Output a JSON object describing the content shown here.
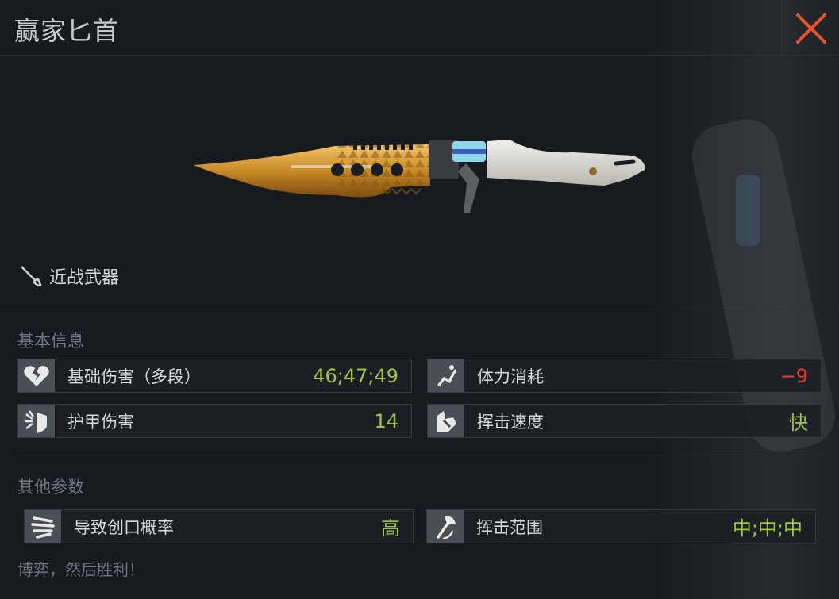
{
  "window": {
    "title": "赢家匕首"
  },
  "weapon": {
    "category": "近战武器"
  },
  "basic_info": {
    "title": "基本信息",
    "stats": [
      {
        "label": "基础伤害（多段）",
        "value": "46;47;49",
        "icon": "broken-heart-icon"
      },
      {
        "label": "体力消耗",
        "value": "−9",
        "icon": "stamina-icon"
      },
      {
        "label": "护甲伤害",
        "value": "14",
        "icon": "armor-break-icon"
      },
      {
        "label": "挥击速度",
        "value": "快",
        "icon": "swing-speed-icon"
      }
    ]
  },
  "other_params": {
    "title": "其他参数",
    "stats": [
      {
        "label": "导致创口概率",
        "value": "高",
        "icon": "wound-icon"
      },
      {
        "label": "挥击范围",
        "value": "中;中;中",
        "icon": "axe-range-icon"
      }
    ]
  },
  "footer": {
    "motto": "博弈，然后胜利！"
  },
  "colors": {
    "accent_close": "#e8532a",
    "value_green": "#9fc145",
    "value_red": "#e03e2d"
  }
}
